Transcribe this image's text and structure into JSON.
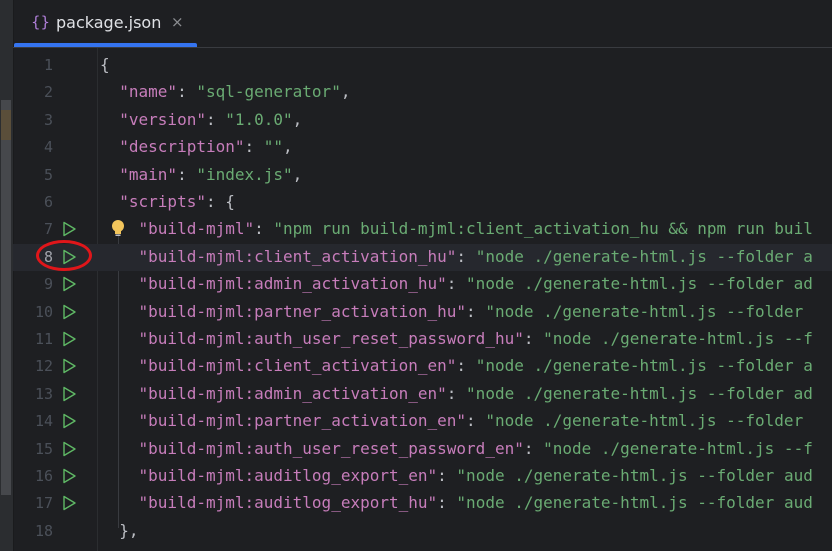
{
  "tab": {
    "icon": "{}",
    "label": "package.json",
    "close": "×"
  },
  "lines": [
    {
      "n": "1",
      "parts": [
        [
          "p",
          "{"
        ]
      ]
    },
    {
      "n": "2",
      "parts": [
        [
          "p",
          "  "
        ],
        [
          "k",
          "\"name\""
        ],
        [
          "p",
          ": "
        ],
        [
          "s",
          "\"sql-generator\""
        ],
        [
          "p",
          ","
        ]
      ]
    },
    {
      "n": "3",
      "parts": [
        [
          "p",
          "  "
        ],
        [
          "k",
          "\"version\""
        ],
        [
          "p",
          ": "
        ],
        [
          "s",
          "\"1.0.0\""
        ],
        [
          "p",
          ","
        ]
      ]
    },
    {
      "n": "4",
      "parts": [
        [
          "p",
          "  "
        ],
        [
          "k",
          "\"description\""
        ],
        [
          "p",
          ": "
        ],
        [
          "s",
          "\"\""
        ],
        [
          "p",
          ","
        ]
      ]
    },
    {
      "n": "5",
      "parts": [
        [
          "p",
          "  "
        ],
        [
          "k",
          "\"main\""
        ],
        [
          "p",
          ": "
        ],
        [
          "s",
          "\"index.js\""
        ],
        [
          "p",
          ","
        ]
      ]
    },
    {
      "n": "6",
      "parts": [
        [
          "p",
          "  "
        ],
        [
          "k",
          "\"scripts\""
        ],
        [
          "p",
          ": {"
        ]
      ]
    },
    {
      "n": "7",
      "run": true,
      "bulb": true,
      "parts": [
        [
          "p",
          "    "
        ],
        [
          "k",
          "\"build-mjml\""
        ],
        [
          "p",
          ": "
        ],
        [
          "s",
          "\"npm run build-mjml:client_activation_hu && npm run buil"
        ]
      ]
    },
    {
      "n": "8",
      "run": true,
      "current": true,
      "parts": [
        [
          "p",
          "    "
        ],
        [
          "k",
          "\"build-mjml:client_activation_hu\""
        ],
        [
          "p",
          ": "
        ],
        [
          "s",
          "\"node ./generate-html.js --folder a"
        ]
      ]
    },
    {
      "n": "9",
      "run": true,
      "parts": [
        [
          "p",
          "    "
        ],
        [
          "k",
          "\"build-mjml:admin_activation_hu\""
        ],
        [
          "p",
          ": "
        ],
        [
          "s",
          "\"node ./generate-html.js --folder ad"
        ]
      ]
    },
    {
      "n": "10",
      "run": true,
      "parts": [
        [
          "p",
          "    "
        ],
        [
          "k",
          "\"build-mjml:partner_activation_hu\""
        ],
        [
          "p",
          ": "
        ],
        [
          "s",
          "\"node ./generate-html.js --folder"
        ]
      ]
    },
    {
      "n": "11",
      "run": true,
      "parts": [
        [
          "p",
          "    "
        ],
        [
          "k",
          "\"build-mjml:auth_user_reset_password_hu\""
        ],
        [
          "p",
          ": "
        ],
        [
          "s",
          "\"node ./generate-html.js --f"
        ]
      ]
    },
    {
      "n": "12",
      "run": true,
      "parts": [
        [
          "p",
          "    "
        ],
        [
          "k",
          "\"build-mjml:client_activation_en\""
        ],
        [
          "p",
          ": "
        ],
        [
          "s",
          "\"node ./generate-html.js --folder a"
        ]
      ]
    },
    {
      "n": "13",
      "run": true,
      "parts": [
        [
          "p",
          "    "
        ],
        [
          "k",
          "\"build-mjml:admin_activation_en\""
        ],
        [
          "p",
          ": "
        ],
        [
          "s",
          "\"node ./generate-html.js --folder ad"
        ]
      ]
    },
    {
      "n": "14",
      "run": true,
      "parts": [
        [
          "p",
          "    "
        ],
        [
          "k",
          "\"build-mjml:partner_activation_en\""
        ],
        [
          "p",
          ": "
        ],
        [
          "s",
          "\"node ./generate-html.js --folder"
        ]
      ]
    },
    {
      "n": "15",
      "run": true,
      "parts": [
        [
          "p",
          "    "
        ],
        [
          "k",
          "\"build-mjml:auth_user_reset_password_en\""
        ],
        [
          "p",
          ": "
        ],
        [
          "s",
          "\"node ./generate-html.js --f"
        ]
      ]
    },
    {
      "n": "16",
      "run": true,
      "parts": [
        [
          "p",
          "    "
        ],
        [
          "k",
          "\"build-mjml:auditlog_export_en\""
        ],
        [
          "p",
          ": "
        ],
        [
          "s",
          "\"node ./generate-html.js --folder aud"
        ]
      ]
    },
    {
      "n": "17",
      "run": true,
      "parts": [
        [
          "p",
          "    "
        ],
        [
          "k",
          "\"build-mjml:auditlog_export_hu\""
        ],
        [
          "p",
          ": "
        ],
        [
          "s",
          "\"node ./generate-html.js --folder aud"
        ]
      ]
    },
    {
      "n": "18",
      "parts": [
        [
          "p",
          "  },"
        ]
      ]
    }
  ],
  "colors": {
    "key": "#c77dbb",
    "string": "#6aab73",
    "accent": "#3574f0",
    "annotation": "#e0161a"
  }
}
